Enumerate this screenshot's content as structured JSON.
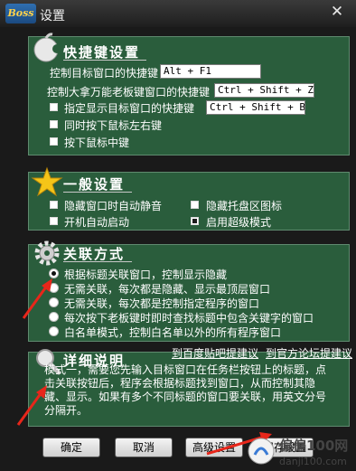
{
  "window": {
    "title": "设置",
    "logo_text": "Boss",
    "close_symbol": "✕"
  },
  "hotkeys": {
    "heading": "快捷键设置",
    "target_label": "控制目标窗口的快捷键",
    "target_value": "Alt + F1",
    "boss_label": "控制大拿万能老板键窗口的快捷键",
    "boss_value": "Ctrl + Shift + Z",
    "show_label": "指定显示目标窗口的快捷键",
    "show_value": "Ctrl + Shift + B",
    "mouse_lr_label": "同时按下鼠标左右键",
    "mouse_mid_label": "按下鼠标中键"
  },
  "general": {
    "heading": "一般设置",
    "mute_label": "隐藏窗口时自动静音",
    "tray_label": "隐藏托盘区图标",
    "autostart_label": "开机自动启动",
    "super_label": "启用超级模式"
  },
  "association": {
    "heading": "关联方式",
    "options": [
      "根据标题关联窗口，控制显示隐藏",
      "无需关联，每次都是隐藏、显示最顶层窗口",
      "无需关联，每次都是控制指定程序的窗口",
      "每次按下老板键时即时查找标题中包含关键字的窗口",
      "白名单模式，控制白名单以外的所有程序窗口"
    ]
  },
  "details": {
    "heading": "详细说明",
    "link_baidu": "到百度贴吧提建议",
    "link_forum": "到官方论坛提建议",
    "text": "模式一，需要您先输入目标窗口在任务栏按钮上的标题，点击关联按钮后，程序会根据标题找到窗口，从而控制其隐藏、显示。如果有多个不同标题的窗口要关联，用英文分号分隔开。"
  },
  "buttons": {
    "ok": "确定",
    "cancel": "取消",
    "advanced": "高级设置",
    "save": "保存设置"
  },
  "watermark": {
    "site": "偏偏100网",
    "url": "danji100.com"
  },
  "colors": {
    "panel": "#2a5d3c",
    "arrow": "#e8261a",
    "background": "#1a1a1a"
  }
}
